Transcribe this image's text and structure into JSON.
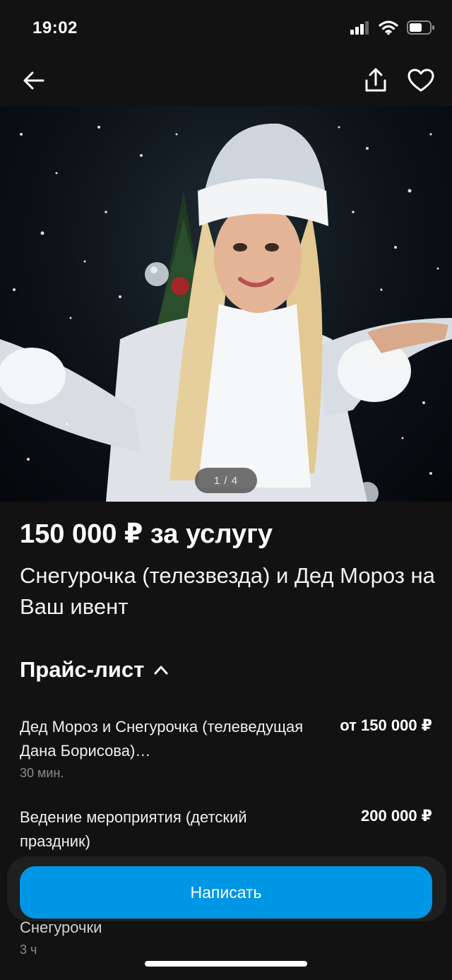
{
  "status_bar": {
    "time": "19:02",
    "icons": [
      "signal-icon",
      "wifi-icon",
      "battery-icon"
    ]
  },
  "nav": {
    "icons": [
      "back-arrow-icon",
      "share-icon",
      "heart-icon"
    ]
  },
  "gallery": {
    "counter": "1 / 4"
  },
  "listing": {
    "price": "150 000 ₽ за услугу",
    "title": "Снегурочка (телезвезда) и Дед Мороз на Ваш ивент"
  },
  "price_list": {
    "header": "Прайс-лист",
    "items": [
      {
        "name": "Дед Мороз и Снегурочка (телеведущая Дана Борисова)…",
        "price": "от 150 000 ₽",
        "duration": "30 мин."
      },
      {
        "name": "Ведение мероприятия (детский праздник)",
        "price": "200 000 ₽",
        "duration": ""
      },
      {
        "name": "Снегурочки",
        "price": "",
        "duration": "3 ч"
      }
    ]
  },
  "actions": {
    "write_label": "Написать"
  },
  "colors": {
    "accent": "#0096e6",
    "background": "#121212",
    "muted_text": "#8a8a8a"
  }
}
